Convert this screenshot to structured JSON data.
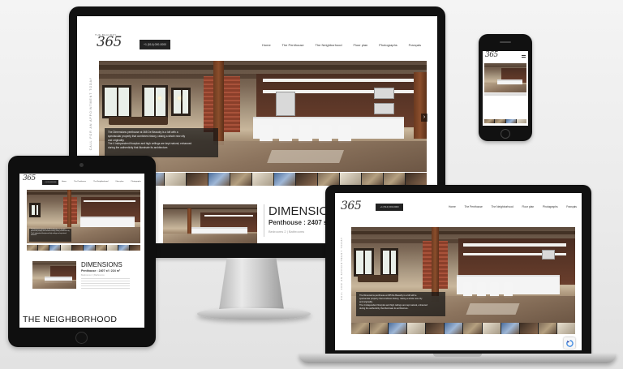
{
  "site": {
    "logo_text": "365",
    "logo_tagline": "THE BEAUDRY",
    "phone_label": "+1 (514) 000-0000",
    "nav": [
      "Home",
      "The Penthouse",
      "The Neighborhood",
      "Floor plan",
      "Photographs",
      "Français"
    ],
    "vertical_text": "CALL FOR AN APPOINTMENT TODAY",
    "caption_lines": [
      "The Dimensions penthouse at 365 De Beaudry is a loft with a",
      "spectacular property that combines history, raising a whole new city",
      "and originality.",
      "The 4 independent floorplan and high ceilings are kept natural, enhanced",
      "during the authenticity that illuminate its architecture."
    ],
    "dimensions_title": "DIMENSIONS",
    "dimensions_sub": "Penthouse : 2407 sf / 3",
    "dimensions_sub_tablet": "Penthouse : 2407 sf / 224 m²",
    "dimensions_small": "Bedrooms 2 | Bathrooms",
    "neighborhood_title": "THE NEIGHBORHOOD"
  },
  "colors": {
    "device_black": "#111111",
    "caption_bg": "#141414",
    "wood": "#6a3e2c",
    "accent_recaptcha": "#4a90e2"
  },
  "icons": {
    "next_arrow": "›",
    "recaptcha": "recaptcha-icon"
  }
}
